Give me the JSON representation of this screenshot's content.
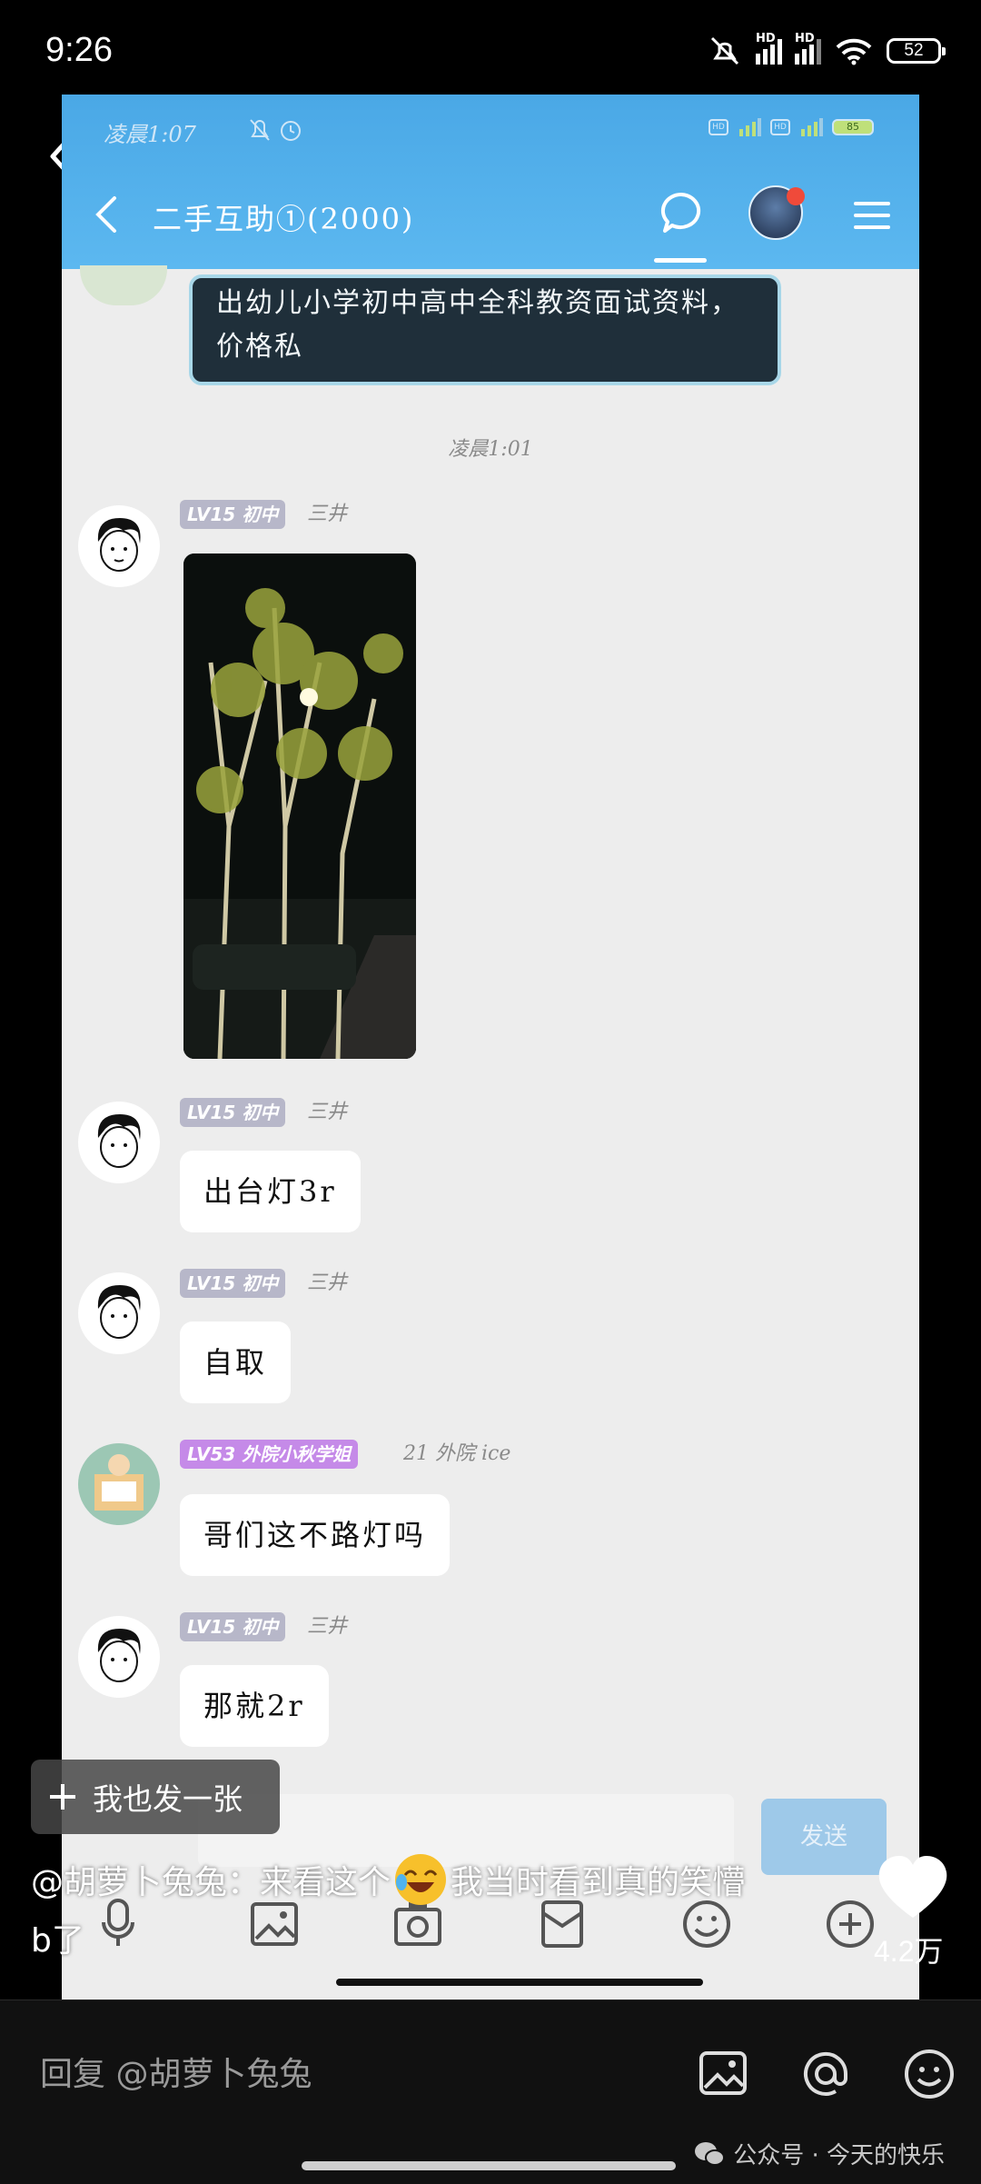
{
  "status_bar": {
    "time": "9:26",
    "battery": "52",
    "hd1": "HD",
    "hd2": "HD"
  },
  "inner": {
    "status_time": "凌晨1:07",
    "battery": "85",
    "hd": "HD",
    "title": "二手互助①(2000)",
    "first_message": "出幼儿小学初中高中全科教资面试资料，价格私",
    "timestamp": "凌晨1:01",
    "messages": [
      {
        "level": "LV15 初中",
        "nick": "三井",
        "text": ""
      },
      {
        "level": "LV15 初中",
        "nick": "三井",
        "text": "出台灯3r"
      },
      {
        "level": "LV15 初中",
        "nick": "三井",
        "text": "自取"
      },
      {
        "level": "LV53 外院小秋学姐",
        "nick": "21 外院 ice",
        "text": "哥们这不路灯吗"
      },
      {
        "level": "LV15 初中",
        "nick": "三井",
        "text": "那就2r"
      }
    ],
    "send_label": "发送"
  },
  "overlay": {
    "add_label": "我也发一张",
    "caption_part1": "@胡萝卜兔兔：来看这个",
    "caption_part2": "我当时看到真的笑懵b了",
    "likes": "4.2万"
  },
  "reply": {
    "placeholder": "回复 @胡萝卜兔兔",
    "watermark": "公众号 · 今天的快乐"
  },
  "icons": [
    "back-icon",
    "chat-icon",
    "menu-icon",
    "heart-icon",
    "image-icon",
    "at-icon",
    "emoji-icon",
    "plus-icon",
    "mic-icon",
    "camera-icon",
    "wechat-icon"
  ]
}
